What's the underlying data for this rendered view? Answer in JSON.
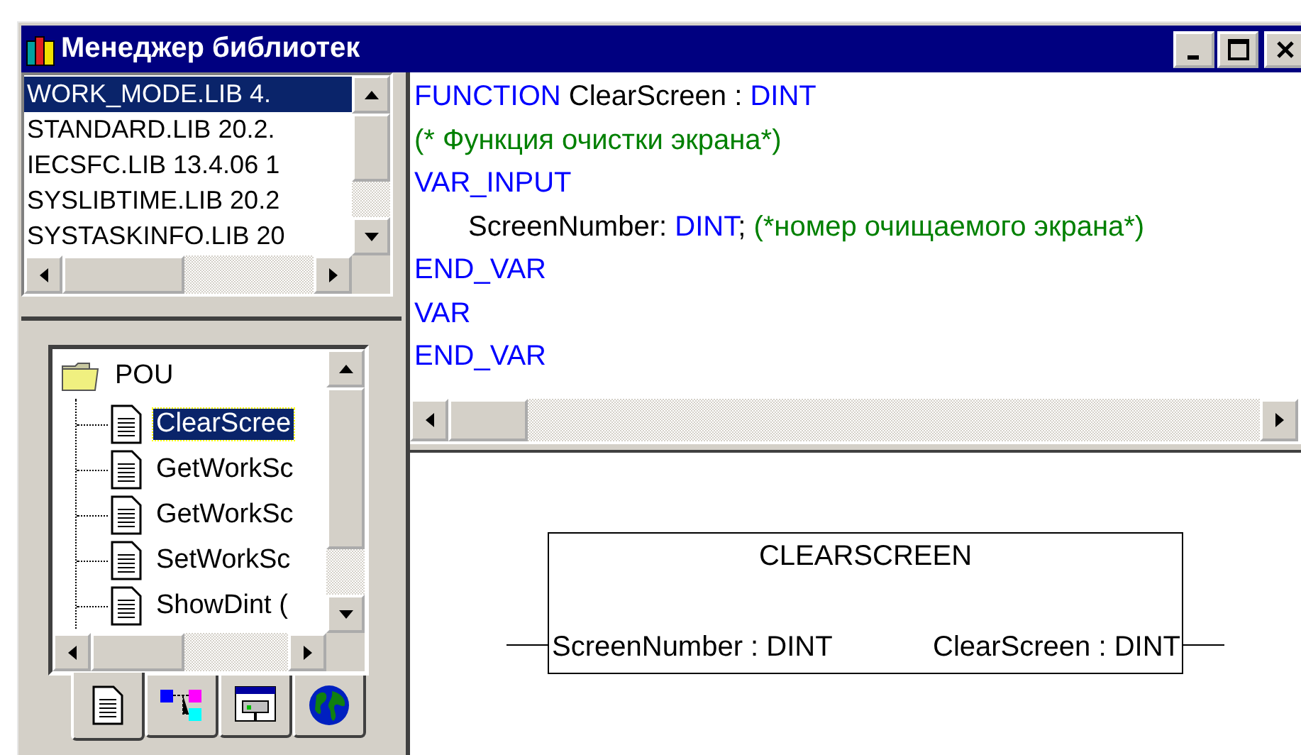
{
  "window": {
    "title": "Менеджер библиотек"
  },
  "libraries": [
    {
      "name": "WORK_MODE.LIB 4.",
      "selected": true
    },
    {
      "name": "STANDARD.LIB 20.2.",
      "selected": false
    },
    {
      "name": "IECSFC.LIB 13.4.06 1",
      "selected": false
    },
    {
      "name": "SYSLIBTIME.LIB 20.2",
      "selected": false
    },
    {
      "name": "SYSTASKINFO.LIB 20",
      "selected": false
    }
  ],
  "tree": {
    "label": "POU",
    "children": [
      {
        "label": "ClearScree",
        "selected": true
      },
      {
        "label": "GetWorkSc",
        "selected": false
      },
      {
        "label": "GetWorkSc",
        "selected": false
      },
      {
        "label": "SetWorkSc",
        "selected": false
      },
      {
        "label": "ShowDint (",
        "selected": false
      }
    ]
  },
  "tabs": [
    {
      "kind": "pou",
      "selected": true
    },
    {
      "kind": "types",
      "selected": false
    },
    {
      "kind": "visuals",
      "selected": false
    },
    {
      "kind": "globals",
      "selected": false
    }
  ],
  "code": [
    {
      "indented": false,
      "tokens": [
        {
          "kind": "keyword",
          "text": "FUNCTION"
        },
        {
          "kind": "plain",
          "text": " ClearScreen : "
        },
        {
          "kind": "keyword",
          "text": "DINT"
        }
      ]
    },
    {
      "indented": false,
      "tokens": [
        {
          "kind": "comment",
          "text": "(* Функция очистки экрана*)"
        }
      ]
    },
    {
      "indented": false,
      "tokens": [
        {
          "kind": "keyword",
          "text": "VAR_INPUT"
        }
      ]
    },
    {
      "indented": true,
      "tokens": [
        {
          "kind": "plain",
          "text": "ScreenNumber: "
        },
        {
          "kind": "keyword",
          "text": "DINT"
        },
        {
          "kind": "plain",
          "text": "; "
        },
        {
          "kind": "comment",
          "text": "(*номер очищаемого экрана*)"
        }
      ]
    },
    {
      "indented": false,
      "tokens": [
        {
          "kind": "keyword",
          "text": "END_VAR"
        }
      ]
    },
    {
      "indented": false,
      "tokens": [
        {
          "kind": "keyword",
          "text": "VAR"
        }
      ]
    },
    {
      "indented": false,
      "tokens": [
        {
          "kind": "keyword",
          "text": "END_VAR"
        }
      ]
    }
  ],
  "diagram": {
    "title": "CLEARSCREEN",
    "input": "ScreenNumber : DINT",
    "output": "ClearScreen : DINT"
  }
}
